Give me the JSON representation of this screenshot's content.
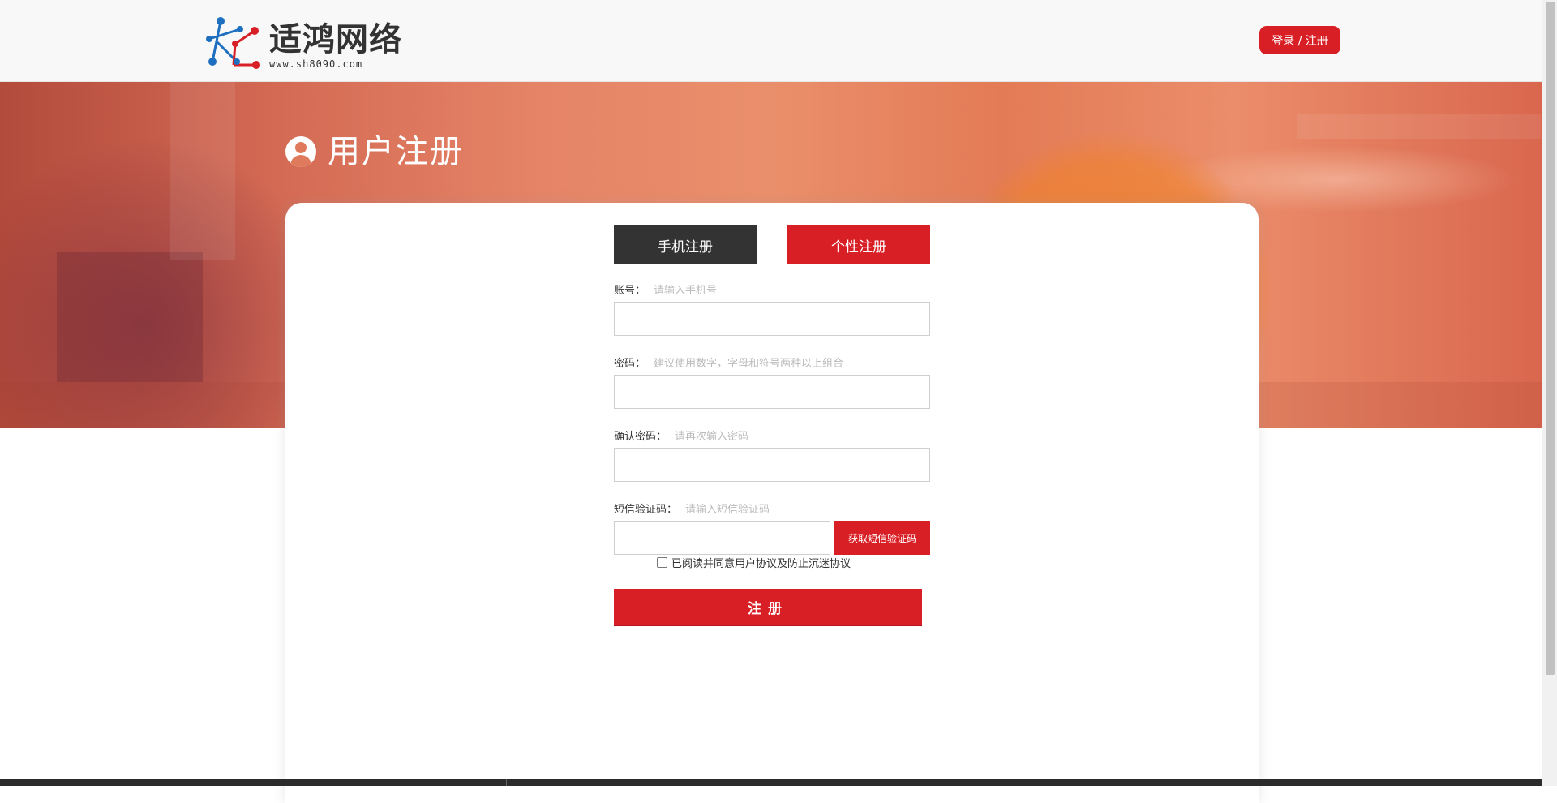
{
  "header": {
    "logo_title": "适鸿网络",
    "logo_url": "www.sh8090.com",
    "login_label": "登录 / 注册"
  },
  "banner": {
    "page_title": "用户注册"
  },
  "tabs": {
    "phone_label": "手机注册",
    "custom_label": "个性注册"
  },
  "form": {
    "account": {
      "label": "账号：",
      "hint": "请输入手机号",
      "value": ""
    },
    "password": {
      "label": "密码：",
      "hint": "建议使用数字，字母和符号两种以上组合",
      "value": ""
    },
    "confirm": {
      "label": "确认密码：",
      "hint": "请再次输入密码",
      "value": ""
    },
    "sms": {
      "label": "短信验证码：",
      "hint": "请输入短信验证码",
      "value": "",
      "button_label": "获取短信验证码"
    },
    "agree_label": "已阅读并同意用户协议及防止沉迷协议",
    "agree_checked": false,
    "submit_label": "注册"
  },
  "colors": {
    "brand_red": "#d81f26",
    "tab_dark": "#333333"
  },
  "icons": {
    "logo": "network-logo-icon",
    "user": "user-circle-icon"
  }
}
